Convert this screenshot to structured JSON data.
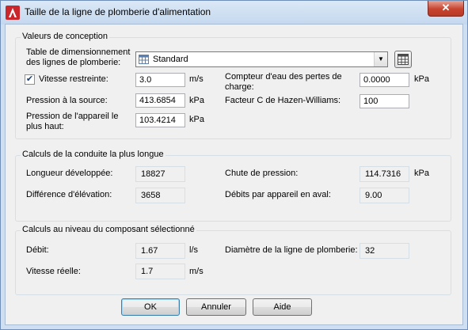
{
  "window": {
    "title": "Taille de la ligne de plomberie d'alimentation",
    "close_label": "✕"
  },
  "design": {
    "group_title": "Valeurs de conception",
    "table_label": "Table de dimensionnement des lignes de plomberie:",
    "table_value": "Standard",
    "restricted_speed_checked": true,
    "restricted_speed_label": "Vitesse restreinte:",
    "restricted_speed_value": "3.0",
    "restricted_speed_unit": "m/s",
    "source_pressure_label": "Pression à la source:",
    "source_pressure_value": "413.6854",
    "source_pressure_unit": "kPa",
    "fixture_pressure_label": "Pression de l'appareil le plus haut:",
    "fixture_pressure_value": "103.4214",
    "fixture_pressure_unit": "kPa",
    "meter_loss_label": "Compteur d'eau des pertes de charge:",
    "meter_loss_value": "0.0000",
    "meter_loss_unit": "kPa",
    "hazen_label": "Facteur C de Hazen-Williams:",
    "hazen_value": "100"
  },
  "longest": {
    "group_title": "Calculs de la conduite la plus longue",
    "developed_length_label": "Longueur développée:",
    "developed_length_value": "18827",
    "elevation_diff_label": "Différence d'élévation:",
    "elevation_diff_value": "3658",
    "pressure_drop_label": "Chute de pression:",
    "pressure_drop_value": "114.7316",
    "pressure_drop_unit": "kPa",
    "downstream_flow_label": "Débits par appareil en aval:",
    "downstream_flow_value": "9.00"
  },
  "selected": {
    "group_title": "Calculs au niveau du composant sélectionné",
    "flow_label": "Débit:",
    "flow_value": "1.67",
    "flow_unit": "l/s",
    "actual_speed_label": "Vitesse réelle:",
    "actual_speed_value": "1.7",
    "actual_speed_unit": "m/s",
    "diameter_label": "Diamètre de la ligne de plomberie:",
    "diameter_value": "32"
  },
  "buttons": {
    "ok": "OK",
    "cancel": "Annuler",
    "help": "Aide"
  },
  "colors": {
    "titlebar": "#c4d8ee",
    "close": "#c7432f",
    "dialog_bg": "#f0f0f0"
  },
  "icons": [
    "autocad-app-icon",
    "close-icon",
    "table-icon",
    "chevron-down-icon",
    "checkmark-icon"
  ]
}
